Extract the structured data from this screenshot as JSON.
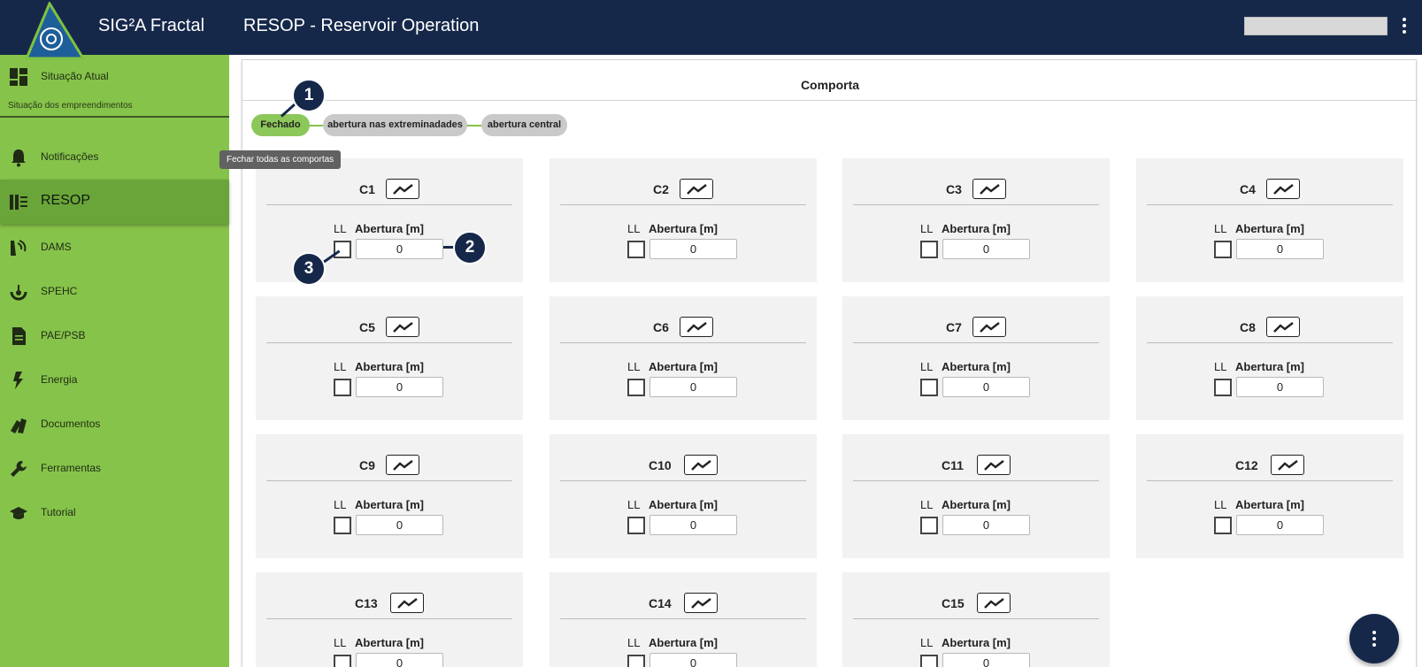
{
  "header": {
    "app_title": "SIG²A Fractal",
    "page_title": "RESOP - Reservoir Operation"
  },
  "sidebar": {
    "items": [
      {
        "label": "Situação Atual",
        "icon": "dashboard-icon"
      },
      {
        "label": "Notificações",
        "icon": "bell-icon"
      },
      {
        "label": "RESOP",
        "icon": "reservoir-icon"
      },
      {
        "label": "DAMS",
        "icon": "dam-icon"
      },
      {
        "label": "SPEHC",
        "icon": "gauge-icon"
      },
      {
        "label": "PAE/PSB",
        "icon": "document-icon"
      },
      {
        "label": "Energia",
        "icon": "lightning-icon"
      },
      {
        "label": "Documentos",
        "icon": "books-icon"
      },
      {
        "label": "Ferramentas",
        "icon": "wrench-icon"
      },
      {
        "label": "Tutorial",
        "icon": "graduation-cap-icon"
      }
    ],
    "subtitle": "Situação dos empreendimentos",
    "active": "RESOP"
  },
  "tooltip": "Fechar todas as comportas",
  "panel": {
    "title": "Comporta",
    "steps": [
      "Fechado",
      "abertura nas extreminadades",
      "abertura central"
    ],
    "active_step": "Fechado"
  },
  "callouts": [
    "1",
    "2",
    "3"
  ],
  "gate_labels": {
    "ll": "LL",
    "opening": "Abertura [m]"
  },
  "gates": [
    {
      "name": "C1",
      "value": "0"
    },
    {
      "name": "C2",
      "value": "0"
    },
    {
      "name": "C3",
      "value": "0"
    },
    {
      "name": "C4",
      "value": "0"
    },
    {
      "name": "C5",
      "value": "0"
    },
    {
      "name": "C6",
      "value": "0"
    },
    {
      "name": "C7",
      "value": "0"
    },
    {
      "name": "C8",
      "value": "0"
    },
    {
      "name": "C9",
      "value": "0"
    },
    {
      "name": "C10",
      "value": "0"
    },
    {
      "name": "C11",
      "value": "0"
    },
    {
      "name": "C12",
      "value": "0"
    },
    {
      "name": "C13",
      "value": "0"
    },
    {
      "name": "C14",
      "value": "0"
    },
    {
      "name": "C15",
      "value": "0"
    }
  ],
  "colors": {
    "header": "#16284a",
    "sidebar": "#86c34a",
    "accent": "#8cc75a"
  }
}
